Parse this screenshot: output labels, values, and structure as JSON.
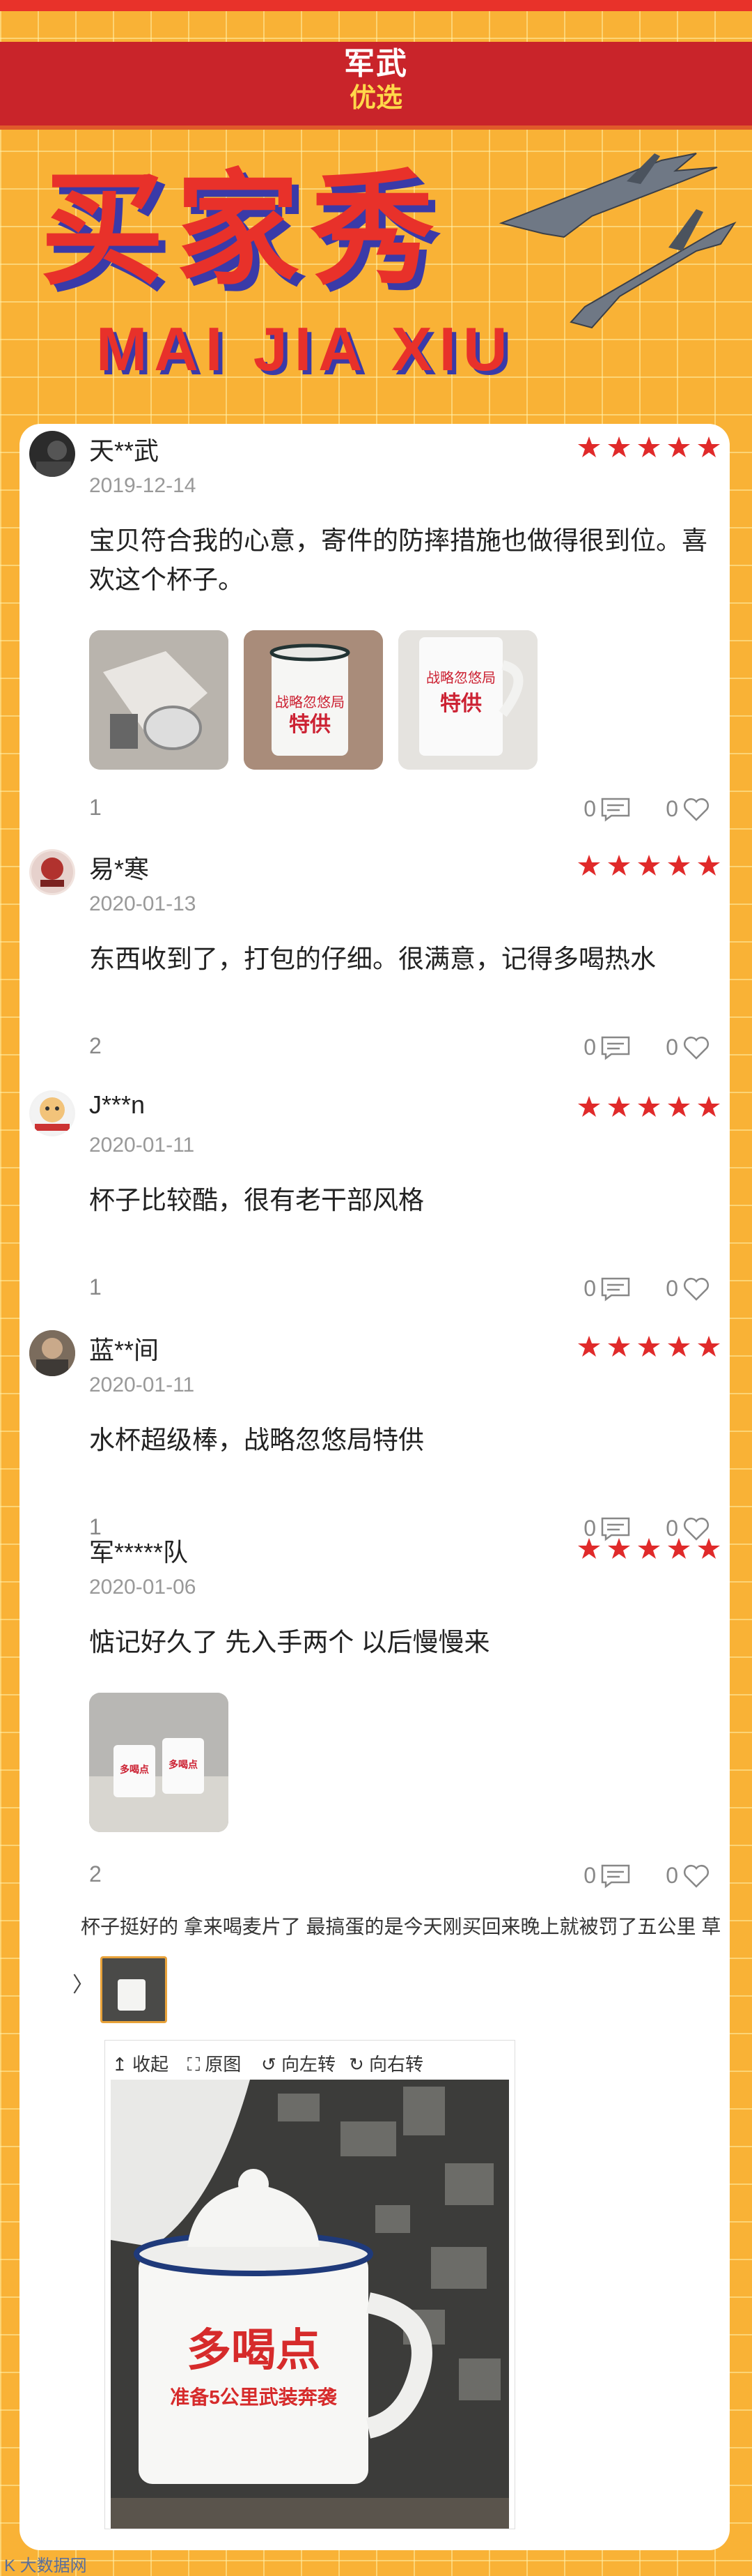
{
  "brand": {
    "line1": "军武",
    "line2": "优选"
  },
  "hero": {
    "title": "买家秀",
    "subtitle": "MAI JIA XIU"
  },
  "reviews": [
    {
      "name": "天**武",
      "date": "2019-12-14",
      "text": "宝贝符合我的心意，寄件的防摔措施也做得很到位。喜欢这个杯子。",
      "count": "1",
      "comments": "0",
      "likes": "0",
      "rating": 5
    },
    {
      "name": "易*寒",
      "date": "2020-01-13",
      "text": "东西收到了，打包的仔细。很满意，记得多喝热水",
      "count": "2",
      "comments": "0",
      "likes": "0",
      "rating": 5
    },
    {
      "name": "J***n",
      "date": "2020-01-11",
      "text": "杯子比较酷，很有老干部风格",
      "count": "1",
      "comments": "0",
      "likes": "0",
      "rating": 5
    },
    {
      "name": "蓝**间",
      "date": "2020-01-11",
      "text": "水杯超级棒，战略忽悠局特供",
      "count": "1",
      "comments": "0",
      "likes": "0",
      "rating": 5
    },
    {
      "name": "军*****队",
      "date": "2020-01-06",
      "text": "惦记好久了 先入手两个 以后慢慢来",
      "count": "2",
      "comments": "0",
      "likes": "0",
      "rating": 5
    }
  ],
  "photos": {
    "mug_text_1": "战略忽悠局",
    "mug_text_2": "特供",
    "small_mug_text": "多喝点"
  },
  "snippet": {
    "text": "杯子挺好的 拿来喝麦片了 最搞蛋的是今天刚买回来晚上就被罚了五公里 草",
    "arrow": "〉"
  },
  "viewer": {
    "collapse": "↥ 收起",
    "original": "⛶ 原图",
    "rotate_left": "↺ 向左转",
    "rotate_right": "↻ 向右转",
    "mug_title": "多喝点",
    "mug_sub": "准备5公里武装奔袭"
  },
  "watermark": "K 大数据网",
  "colors": {
    "accent": "#e8312a",
    "star": "#e02a2a",
    "background": "#f9b236"
  }
}
